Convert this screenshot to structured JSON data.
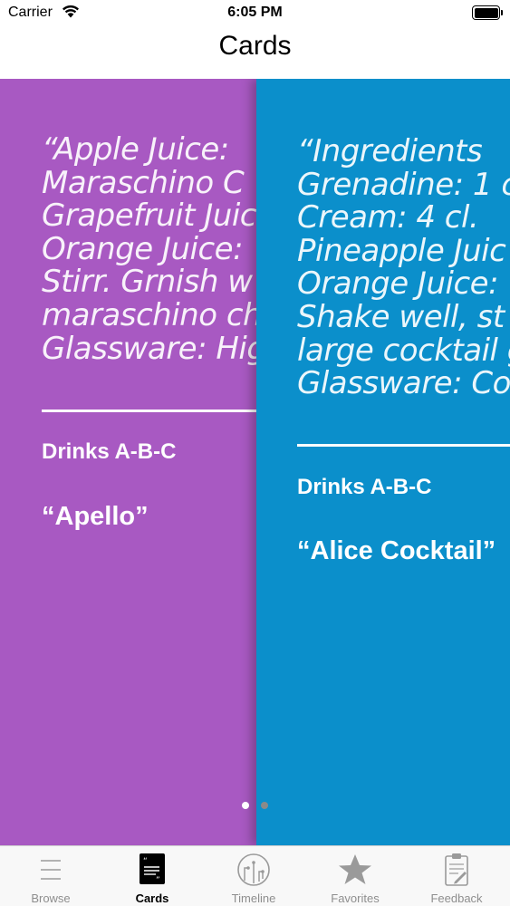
{
  "status_bar": {
    "carrier": "Carrier",
    "time": "6:05 PM"
  },
  "nav": {
    "title": "Cards"
  },
  "cards": [
    {
      "color": "#a859c2",
      "quote_lines": [
        "“Apple Juice:",
        "Maraschino C",
        "Grapefruit Juic",
        "Orange Juice:",
        "Stirr. Grnish w",
        "maraschino ch",
        "Glassware: Hig"
      ],
      "category": "Drinks A-B-C",
      "name": "“Apello”"
    },
    {
      "color": "#0b8fcb",
      "quote_lines": [
        "“Ingredients",
        "Grenadine: 1 c",
        "Cream: 4 cl.",
        "Pineapple Juic",
        "Orange Juice:",
        "Shake well, st",
        "large cocktail g",
        "Glassware: Co"
      ],
      "category": "Drinks A-B-C",
      "name": "“Alice Cocktail”"
    }
  ],
  "pager": {
    "count": 2,
    "current": 1
  },
  "tab_bar": {
    "tabs": [
      {
        "label": "Browse",
        "icon": "list-icon",
        "active": false
      },
      {
        "label": "Cards",
        "icon": "quote-card-icon",
        "active": true
      },
      {
        "label": "Timeline",
        "icon": "timeline-icon",
        "active": false
      },
      {
        "label": "Favorites",
        "icon": "star-icon",
        "active": false
      },
      {
        "label": "Feedback",
        "icon": "clipboard-icon",
        "active": false
      }
    ]
  }
}
